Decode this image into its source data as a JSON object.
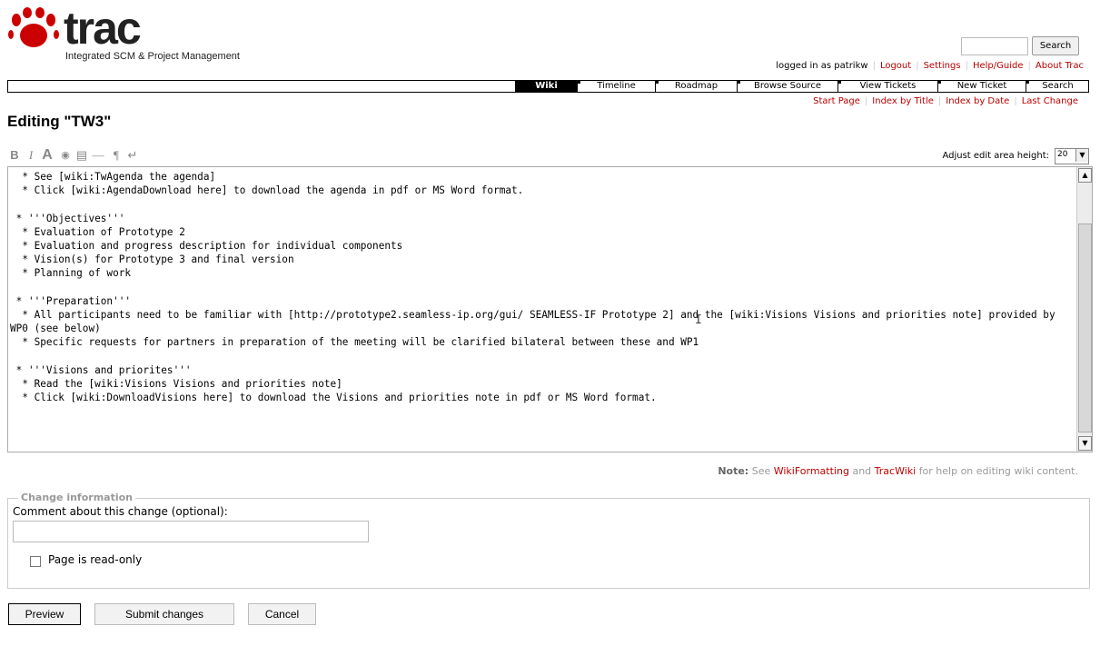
{
  "logo": {
    "word": "trac",
    "tagline": "Integrated SCM & Project Management"
  },
  "search": {
    "button_label": "Search",
    "value": ""
  },
  "metanav": {
    "logged_in": "logged in as patrikw",
    "links": [
      "Logout",
      "Settings",
      "Help/Guide",
      "About Trac"
    ]
  },
  "mainnav": {
    "tabs": [
      {
        "label": "Wiki",
        "active": true
      },
      {
        "label": "Timeline",
        "active": false
      },
      {
        "label": "Roadmap",
        "active": false
      },
      {
        "label": "Browse Source",
        "active": false
      },
      {
        "label": "View Tickets",
        "active": false
      },
      {
        "label": "New Ticket",
        "active": false
      },
      {
        "label": "Search",
        "active": false
      }
    ]
  },
  "ctxnav": {
    "links": [
      "Start Page",
      "Index by Title",
      "Index by Date",
      "Last Change"
    ]
  },
  "page": {
    "title": "Editing \"TW3\""
  },
  "toolbar": {
    "buttons": [
      {
        "icon": "bold-icon",
        "glyph": "B"
      },
      {
        "icon": "italic-icon",
        "glyph": "I"
      },
      {
        "icon": "heading-icon",
        "glyph": "A"
      },
      {
        "icon": "link-icon",
        "glyph": "◉"
      },
      {
        "icon": "code-block-icon",
        "glyph": "▤"
      },
      {
        "icon": "horizontal-rule-icon",
        "glyph": "—"
      },
      {
        "icon": "paragraph-icon",
        "glyph": "¶"
      },
      {
        "icon": "line-break-icon",
        "glyph": "↵"
      }
    ]
  },
  "editor": {
    "height_label": "Adjust edit area height:",
    "height_value": "20",
    "content": "  * See [wiki:TwAgenda the agenda]\n  * Click [wiki:AgendaDownload here] to download the agenda in pdf or MS Word format.\n\n * '''Objectives'''\n  * Evaluation of Prototype 2\n  * Evaluation and progress description for individual components\n  * Vision(s) for Prototype 3 and final version\n  * Planning of work\n\n * '''Preparation'''\n  * All participants need to be familiar with [http://prototype2.seamless-ip.org/gui/ SEAMLESS-IF Prototype 2] and the [wiki:Visions Visions and priorities note] provided by WP0 (see below)\n  * Specific requests for partners in preparation of the meeting will be clarified bilateral between these and WP1\n\n * '''Visions and priorites'''\n  * Read the [wiki:Visions Visions and priorities note]\n  * Click [wiki:DownloadVisions here] to download the Visions and priorities note in pdf or MS Word format."
  },
  "note": {
    "prefix": "Note:",
    "text1": " See ",
    "link1": "WikiFormatting",
    "text2": " and ",
    "link2": "TracWiki",
    "text3": " for help on editing wiki content."
  },
  "change_info": {
    "legend": "Change information",
    "comment_label": "Comment about this change (optional):",
    "comment_value": "",
    "readonly_label": "Page is read-only",
    "readonly_checked": false
  },
  "buttons": {
    "preview": "Preview",
    "submit": "Submit changes",
    "cancel": "Cancel"
  }
}
